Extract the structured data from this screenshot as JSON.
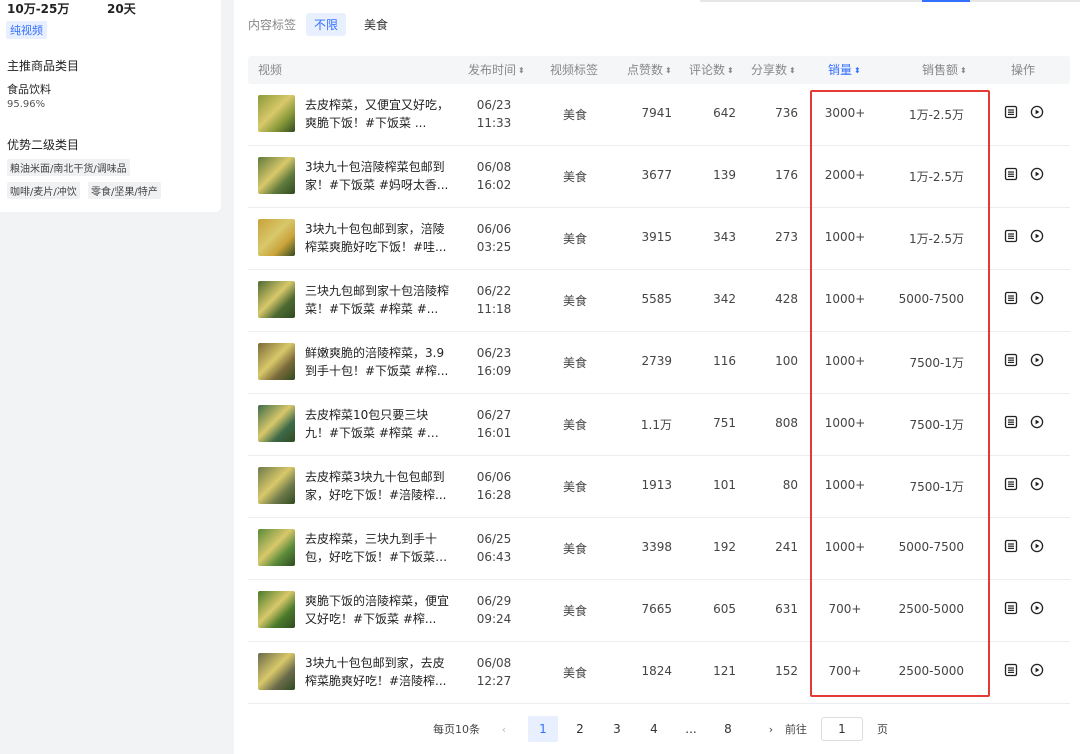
{
  "left_panel": {
    "stat1": "10万-25万",
    "stat2": "20天",
    "tag": "纯视频",
    "main_category_heading": "主推商品类目",
    "main_category": "食品饮料",
    "main_category_pct": "95.96%",
    "secondary_heading": "优势二级类目",
    "secondary_tags": [
      "粮油米面/南北干货/调味品",
      "咖啡/麦片/冲饮",
      "零食/坚果/特产"
    ]
  },
  "filter": {
    "label": "内容标签",
    "options": [
      "不限",
      "美食"
    ]
  },
  "table": {
    "headers": {
      "video": "视频",
      "publish_time": "发布时间",
      "video_tag": "视频标签",
      "likes": "点赞数",
      "comments": "评论数",
      "shares": "分享数",
      "sales": "销量",
      "sales_amount": "销售额",
      "actions": "操作"
    },
    "rows": [
      {
        "title": "去皮榨菜，又便宜又好吃，爽脆下饭！#下饭菜 ...",
        "date": "06/23",
        "time": "11:33",
        "tag": "美食",
        "likes": "7941",
        "comments": "642",
        "shares": "736",
        "sales": "3000+",
        "amount": "1万-2.5万",
        "thumb_color": "#8a9a3a"
      },
      {
        "title": "3块九十包涪陵榨菜包邮到家！#下饭菜 #妈呀太香...",
        "date": "06/08",
        "time": "16:02",
        "tag": "美食",
        "likes": "3677",
        "comments": "139",
        "shares": "176",
        "sales": "2000+",
        "amount": "1万-2.5万",
        "thumb_color": "#5f7a3c"
      },
      {
        "title": "3块九十包包邮到家，涪陵榨菜爽脆好吃下饭！#哇...",
        "date": "06/06",
        "time": "03:25",
        "tag": "美食",
        "likes": "3915",
        "comments": "343",
        "shares": "273",
        "sales": "1000+",
        "amount": "1万-2.5万",
        "thumb_color": "#c9a23a"
      },
      {
        "title": "三块九包邮到家十包涪陵榨菜！#下饭菜 #榨菜 #...",
        "date": "06/22",
        "time": "11:18",
        "tag": "美食",
        "likes": "5585",
        "comments": "342",
        "shares": "428",
        "sales": "1000+",
        "amount": "5000-7500",
        "thumb_color": "#4e6a32"
      },
      {
        "title": "鲜嫩爽脆的涪陵榨菜，3.9到手十包！#下饭菜 #榨...",
        "date": "06/23",
        "time": "16:09",
        "tag": "美食",
        "likes": "2739",
        "comments": "116",
        "shares": "100",
        "sales": "1000+",
        "amount": "7500-1万",
        "thumb_color": "#7a6a3a"
      },
      {
        "title": "去皮榨菜10包只要三块九！#下饭菜 #榨菜 #涪...",
        "date": "06/27",
        "time": "16:01",
        "tag": "美食",
        "likes": "1.1万",
        "comments": "751",
        "shares": "808",
        "sales": "1000+",
        "amount": "7500-1万",
        "thumb_color": "#3e6a4a"
      },
      {
        "title": "去皮榨菜3块九十包包邮到家，好吃下饭！#涪陵榨...",
        "date": "06/06",
        "time": "16:28",
        "tag": "美食",
        "likes": "1913",
        "comments": "101",
        "shares": "80",
        "sales": "1000+",
        "amount": "7500-1万",
        "thumb_color": "#6e7a4a"
      },
      {
        "title": "去皮榨菜，三块九到手十包，好吃下饭！#下饭菜 ...",
        "date": "06/25",
        "time": "06:43",
        "tag": "美食",
        "likes": "3398",
        "comments": "192",
        "shares": "241",
        "sales": "1000+",
        "amount": "5000-7500",
        "thumb_color": "#5a8a3a"
      },
      {
        "title": "爽脆下饭的涪陵榨菜，便宜又好吃！#下饭菜 #榨...",
        "date": "06/29",
        "time": "09:24",
        "tag": "美食",
        "likes": "7665",
        "comments": "605",
        "shares": "631",
        "sales": "700+",
        "amount": "2500-5000",
        "thumb_color": "#4a7a2a"
      },
      {
        "title": "3块九十包包邮到家，去皮榨菜脆爽好吃！#涪陵榨...",
        "date": "06/08",
        "time": "12:27",
        "tag": "美食",
        "likes": "1824",
        "comments": "121",
        "shares": "152",
        "sales": "700+",
        "amount": "2500-5000",
        "thumb_color": "#6a6a4a"
      }
    ]
  },
  "pagination": {
    "page_size": "每页10条",
    "pages": [
      "1",
      "2",
      "3",
      "4",
      "...",
      "8"
    ],
    "current": "1",
    "goto_label": "前往",
    "goto_value": "1",
    "page_suffix": "页"
  },
  "colors": {
    "accent": "#3370ff",
    "highlight": "#e53935"
  }
}
